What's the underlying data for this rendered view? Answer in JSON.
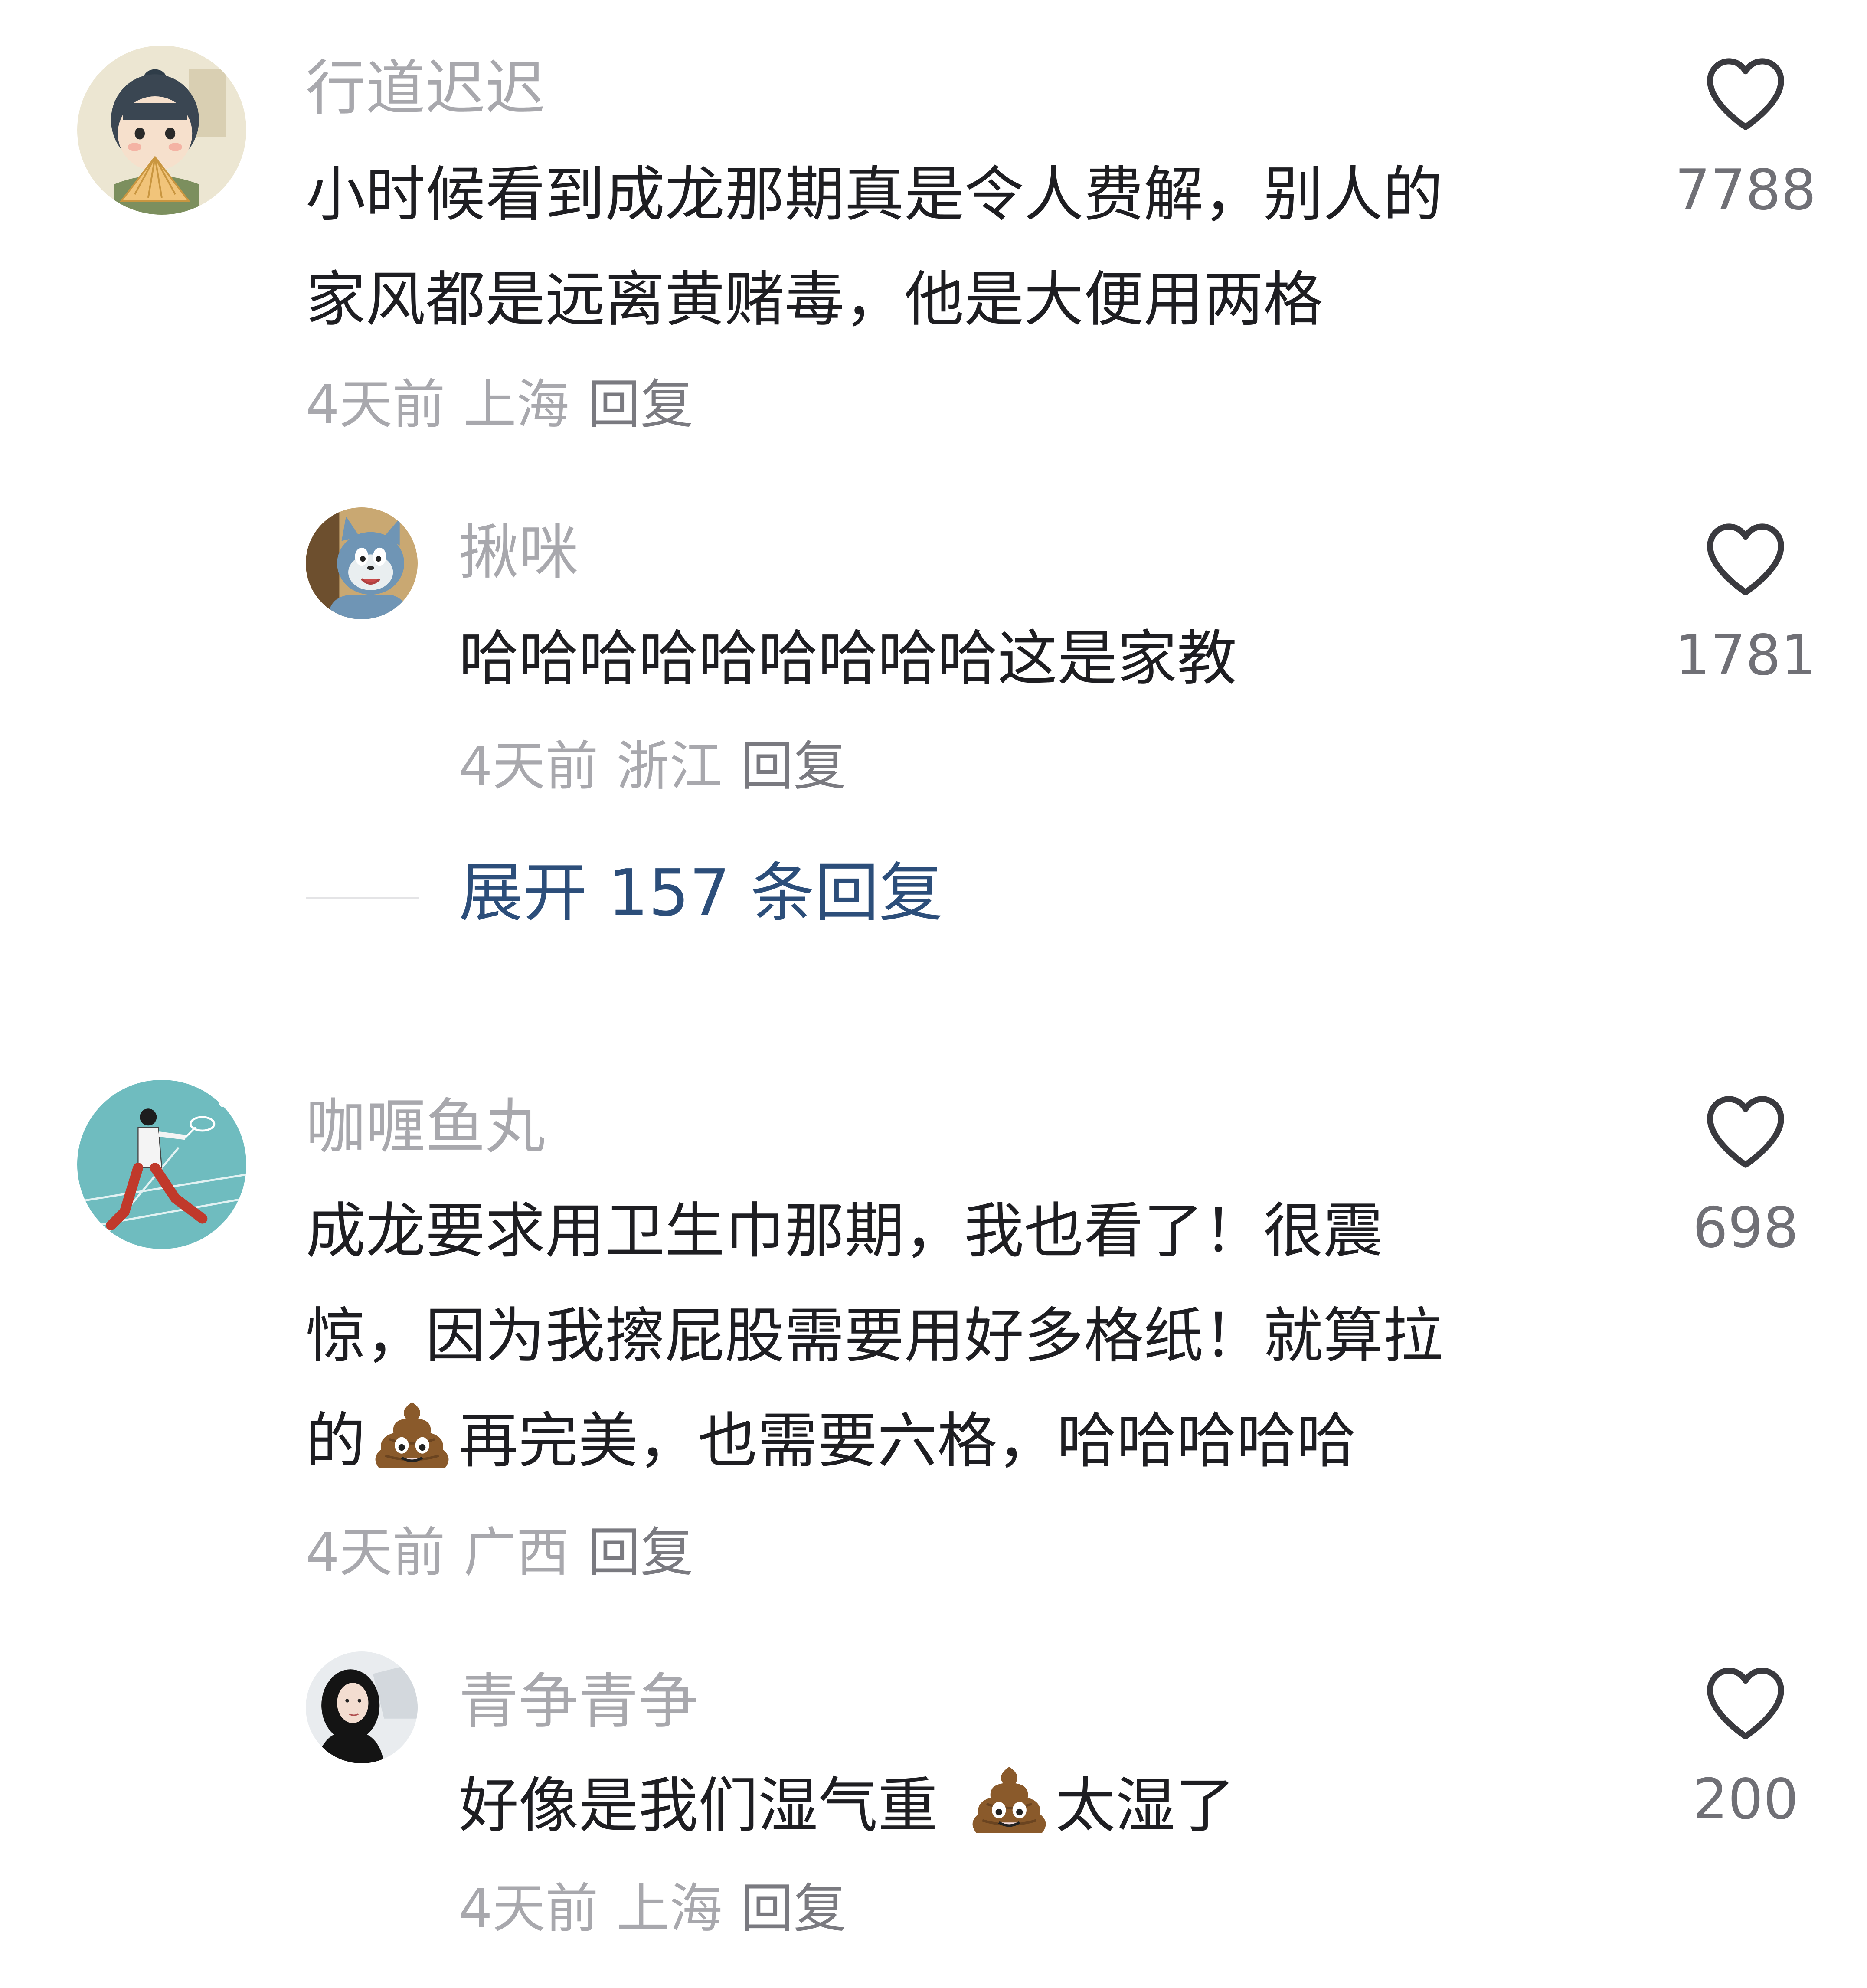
{
  "comments": [
    {
      "username": "行道迟迟",
      "lines": [
        "小时候看到成龙那期真是令人费解，别人的",
        "家风都是远离黄赌毒，他是大便用两格"
      ],
      "time": "4天前",
      "location": "上海",
      "reply_label": "回复",
      "likes": "7788",
      "avatar_icon": "cartoon-person-fan-avatar",
      "sub_reply": {
        "username": "揪咪",
        "text": "哈哈哈哈哈哈哈哈哈这是家教",
        "time": "4天前",
        "location": "浙江",
        "reply_label": "回复",
        "likes": "1781",
        "avatar_icon": "cartoon-cat-avatar"
      },
      "expand_label": "展开 157 条回复"
    },
    {
      "username": "咖喱鱼丸",
      "lines": [
        "成龙要求用卫生巾那期，我也看了！很震",
        "惊，因为我擦屁股需要用好多格纸！就算拉",
        "的",
        "再完美，也需要六格，哈哈哈哈哈"
      ],
      "time": "4天前",
      "location": "广西",
      "reply_label": "回复",
      "likes": "698",
      "avatar_icon": "badminton-player-avatar",
      "sub_reply": {
        "username": "青争青争",
        "text_before": "好像是我们湿气重",
        "text_after": "太湿了",
        "time": "4天前",
        "location": "上海",
        "reply_label": "回复",
        "likes": "200",
        "avatar_icon": "woman-portrait-avatar"
      }
    }
  ],
  "icons": {
    "like": "heart-outline-icon",
    "emoji": "pile-of-poo-emoji"
  },
  "colors": {
    "username": "#a8a8ad",
    "text": "#1e1e22",
    "meta": "#a8a8ad",
    "expand": "#2c4e7a"
  }
}
